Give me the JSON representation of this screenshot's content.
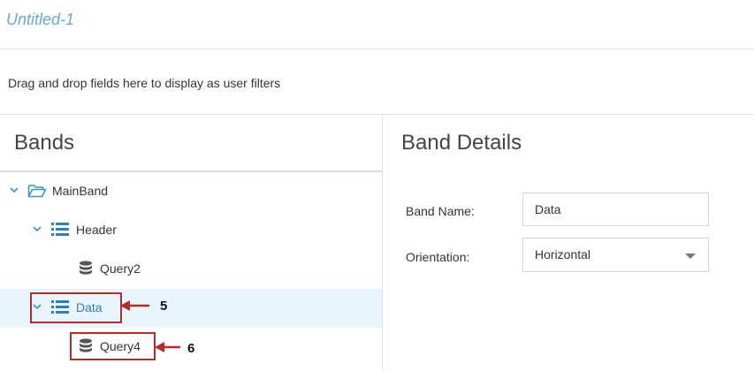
{
  "document": {
    "title": "Untitled-1"
  },
  "filters": {
    "hint": "Drag and drop fields here to display as user filters"
  },
  "bands": {
    "title": "Bands",
    "tree": [
      {
        "label": "MainBand",
        "icon": "folder-open-icon",
        "expanded": true,
        "selected": false
      },
      {
        "label": "Header",
        "icon": "list-icon",
        "expanded": true,
        "selected": false
      },
      {
        "label": "Query2",
        "icon": "database-icon",
        "selected": false
      },
      {
        "label": "Data",
        "icon": "list-icon",
        "expanded": true,
        "selected": true
      },
      {
        "label": "Query4",
        "icon": "database-icon",
        "selected": false
      }
    ]
  },
  "details": {
    "title": "Band Details",
    "band_name_label": "Band Name:",
    "band_name_value": "Data",
    "orientation_label": "Orientation:",
    "orientation_value": "Horizontal"
  },
  "annotations": {
    "callout_5": "5",
    "callout_6": "6"
  },
  "colors": {
    "accent": "#2d7fb8",
    "selected_bg": "#e8f5fc",
    "callout": "#b52a2a",
    "title": "#6aa6d9"
  }
}
